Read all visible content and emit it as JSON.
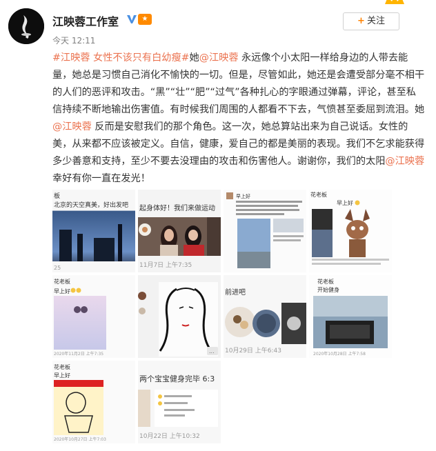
{
  "author": {
    "name": "江映蓉工作室",
    "avatar_icon": "avatar-icon",
    "verified_icon": "verified-v-icon",
    "vip_badge": "vip-badge-icon"
  },
  "follow_button": {
    "label": "关注"
  },
  "post_time": "今天 12:11",
  "post_text": {
    "tags": [
      "#江映蓉 女性不该只有白幼瘦#"
    ],
    "segments": [
      {
        "type": "link",
        "text": "#江映蓉 女性不该只有白幼瘦#"
      },
      {
        "type": "text",
        "text": "她"
      },
      {
        "type": "link",
        "text": "@江映蓉"
      },
      {
        "type": "text",
        "text": " 永远像个小太阳一样给身边的人带去能量，她总是习惯自己消化不愉快的一切。但是，尽管如此，她还是会遭受部分毫不相干的人们的恶评和攻击。“黑”“壮”“肥”“过气”各种扎心的字眼通过弹幕，评论，甚至私信持续不断地输出伤害值。有时候我们周围的人都看不下去，气愤甚至委屈到流泪。她"
      },
      {
        "type": "link",
        "text": "@江映蓉"
      },
      {
        "type": "text",
        "text": " 反而是安慰我们的那个角色。这一次，她总算站出来为自己说话。女性的美，从来都不应该被定义。自信，健康，爱自己的都是美丽的表现。我们不乞求能获得多少善意和支持，至少不要去没理由的攻击和伤害他人。谢谢你，我们的太阳"
      },
      {
        "type": "link",
        "text": "@江映蓉"
      },
      {
        "type": "text",
        "text": " 幸好有你一直在发光！"
      }
    ]
  },
  "images": [
    {
      "id": "img1",
      "caption_top": "北京的天空真美，好出发吧",
      "nickname": "板",
      "date_text": "25"
    },
    {
      "id": "img2",
      "caption_top": "起身体好！我们来做运动",
      "date_text": "11月7日 上午7:35"
    },
    {
      "id": "img3",
      "caption_top": "早上好",
      "date_text": ""
    },
    {
      "id": "img4",
      "nickname": "花老板",
      "caption_top": "早上好",
      "date_text": ""
    },
    {
      "id": "img5",
      "nickname": "花老板",
      "caption_top": "早上好",
      "date_text": "2020年11月2日 上午7:35"
    },
    {
      "id": "img6",
      "caption_top": "",
      "date_text": ""
    },
    {
      "id": "img7",
      "caption_top": "前进吧",
      "date_text": "10月29日 上午6:43"
    },
    {
      "id": "img8",
      "nickname": "花老板",
      "caption_top": "开始健身",
      "date_text": "2020年10月28日 上午7:58"
    },
    {
      "id": "img9",
      "nickname": "花老板",
      "caption_top": "早上好",
      "date_text": "2020年10月27日 上午7:03"
    },
    {
      "id": "img10",
      "caption_top": "两个宝宝健身完毕 6:3",
      "date_text": "10月22日 上午10:32"
    }
  ]
}
